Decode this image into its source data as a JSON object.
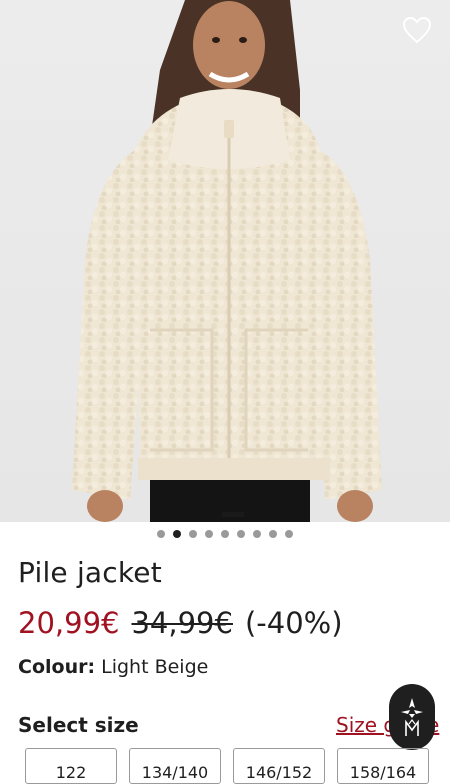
{
  "product": {
    "title": "Pile jacket",
    "price_now": "20,99€",
    "price_old": "34,99€",
    "discount": "(-40%)",
    "colour_label": "Colour:",
    "colour_value": "Light Beige"
  },
  "gallery": {
    "slide_count": 9,
    "active_index": 1,
    "favorite_icon": "heart-icon"
  },
  "size": {
    "section_label": "Select size",
    "guide_link": "Size guide",
    "options": [
      "122",
      "134/140",
      "146/152",
      "158/164"
    ]
  },
  "colors": {
    "accent": "#a01221",
    "text": "#1f1f1f"
  }
}
